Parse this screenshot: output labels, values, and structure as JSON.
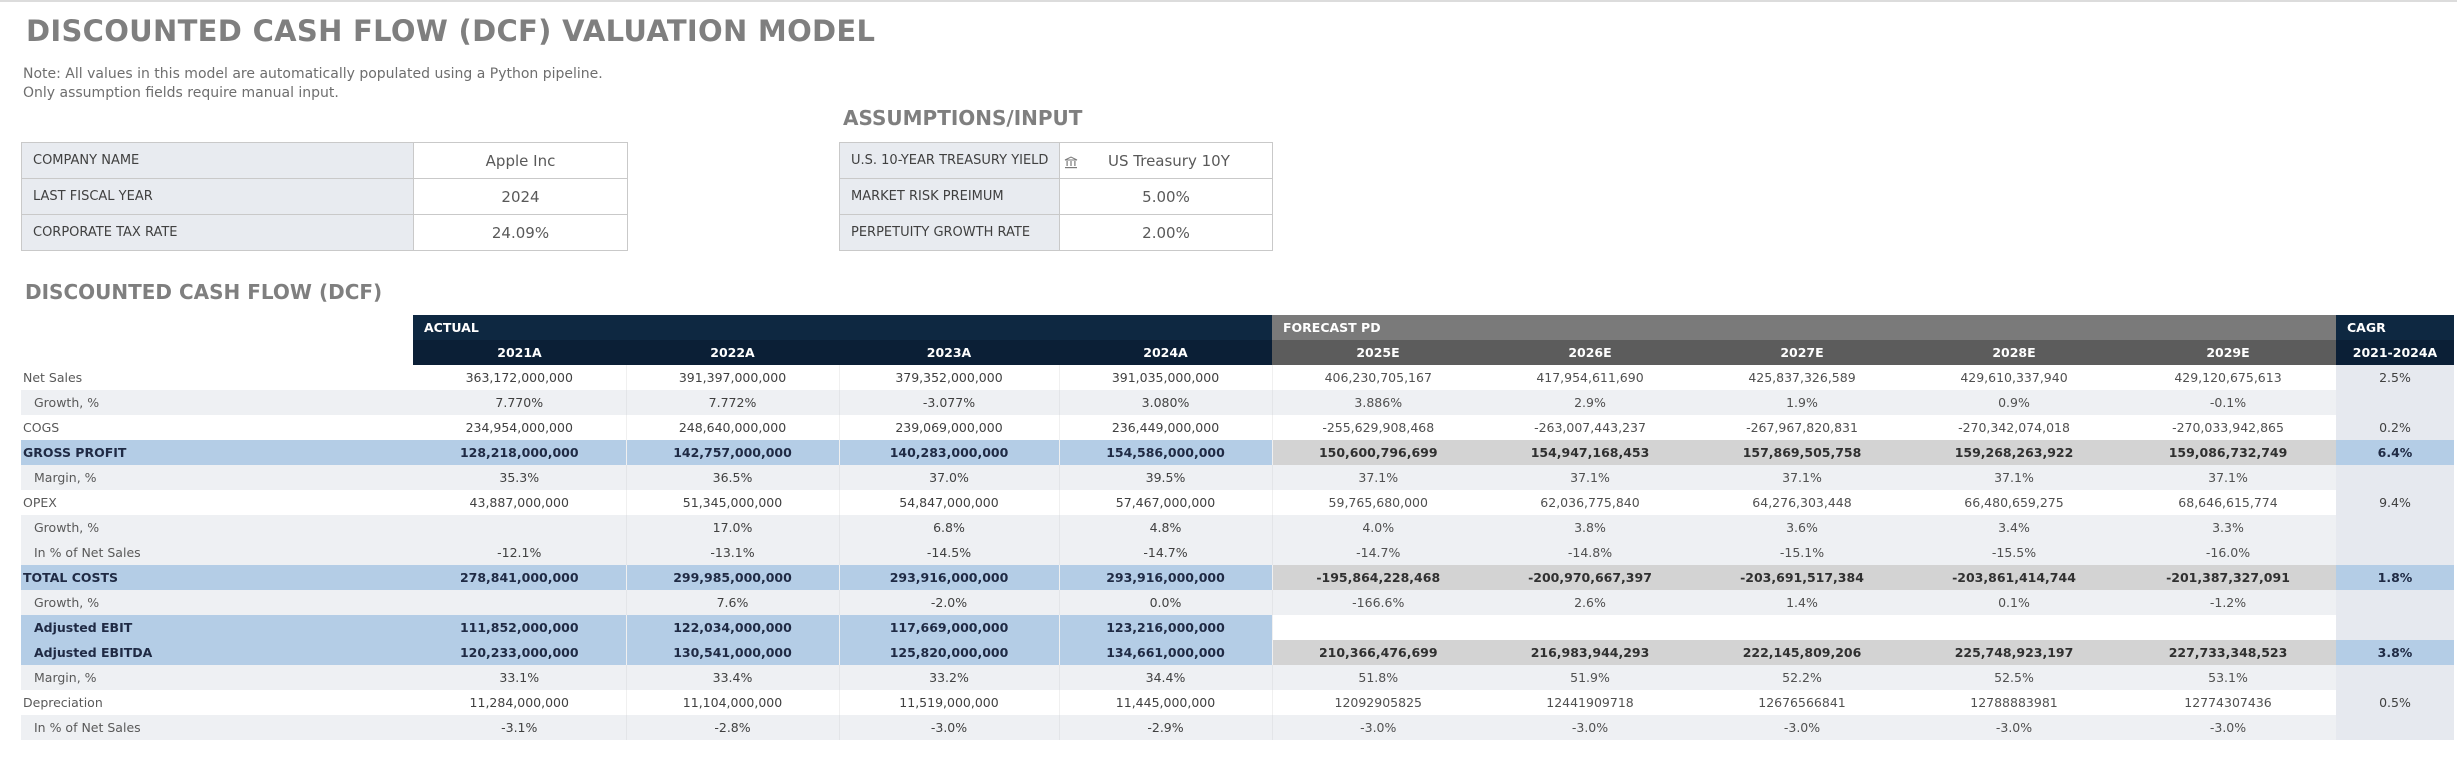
{
  "title": "DISCOUNTED CASH FLOW (DCF) VALUATION MODEL",
  "note": "Note: All values in this model are automatically populated using a Python pipeline. Only assumption fields require manual input.",
  "assumptions_title": "ASSUMPTIONS/INPUT",
  "dcf_title": "DISCOUNTED CASH FLOW (DCF)",
  "company": {
    "rows": [
      {
        "label": "COMPANY NAME",
        "value": "Apple Inc"
      },
      {
        "label": "LAST FISCAL YEAR",
        "value": "2024"
      },
      {
        "label": "CORPORATE TAX RATE",
        "value": "24.09%"
      }
    ]
  },
  "assumptions": {
    "rows": [
      {
        "label": "U.S. 10-YEAR TREASURY YIELD",
        "value": "US Treasury 10Y",
        "icon": "bank-icon"
      },
      {
        "label": "MARKET RISK PREIMUM",
        "value": "5.00%"
      },
      {
        "label": "PERPETUITY GROWTH RATE",
        "value": "2.00%"
      }
    ]
  },
  "dcf": {
    "group_actual": "ACTUAL",
    "group_forecast": "FORECAST PD",
    "group_cagr": "CAGR",
    "years_actual": [
      "2021A",
      "2022A",
      "2023A",
      "2024A"
    ],
    "years_forecast": [
      "2025E",
      "2026E",
      "2027E",
      "2028E",
      "2029E"
    ],
    "cagr_period": "2021-2024A",
    "rows": [
      {
        "label": "Net Sales",
        "actual": [
          "363,172,000,000",
          "391,397,000,000",
          "379,352,000,000",
          "391,035,000,000"
        ],
        "forecast": [
          "406,230,705,167",
          "417,954,611,690",
          "425,837,326,589",
          "429,610,337,940",
          "429,120,675,613"
        ],
        "cagr": "2.5%"
      },
      {
        "label": "Growth, %",
        "actual": [
          "7.770%",
          "7.772%",
          "-3.077%",
          "3.080%"
        ],
        "forecast": [
          "3.886%",
          "2.9%",
          "1.9%",
          "0.9%",
          "-0.1%"
        ],
        "cagr": ""
      },
      {
        "label": "COGS",
        "actual": [
          "234,954,000,000",
          "248,640,000,000",
          "239,069,000,000",
          "236,449,000,000"
        ],
        "forecast": [
          "-255,629,908,468",
          "-263,007,443,237",
          "-267,967,820,831",
          "-270,342,074,018",
          "-270,033,942,865"
        ],
        "cagr": "0.2%"
      },
      {
        "label": "GROSS PROFIT",
        "actual": [
          "128,218,000,000",
          "142,757,000,000",
          "140,283,000,000",
          "154,586,000,000"
        ],
        "forecast": [
          "150,600,796,699",
          "154,947,168,453",
          "157,869,505,758",
          "159,268,263,922",
          "159,086,732,749"
        ],
        "cagr": "6.4%"
      },
      {
        "label": "Margin, %",
        "actual": [
          "35.3%",
          "36.5%",
          "37.0%",
          "39.5%"
        ],
        "forecast": [
          "37.1%",
          "37.1%",
          "37.1%",
          "37.1%",
          "37.1%"
        ],
        "cagr": ""
      },
      {
        "label": "OPEX",
        "actual": [
          "43,887,000,000",
          "51,345,000,000",
          "54,847,000,000",
          "57,467,000,000"
        ],
        "forecast": [
          "59,765,680,000",
          "62,036,775,840",
          "64,276,303,448",
          "66,480,659,275",
          "68,646,615,774"
        ],
        "cagr": "9.4%"
      },
      {
        "label": "Growth, %",
        "actual": [
          "",
          "17.0%",
          "6.8%",
          "4.8%"
        ],
        "forecast": [
          "4.0%",
          "3.8%",
          "3.6%",
          "3.4%",
          "3.3%"
        ],
        "cagr": ""
      },
      {
        "label": "In % of Net Sales",
        "actual": [
          "-12.1%",
          "-13.1%",
          "-14.5%",
          "-14.7%"
        ],
        "forecast": [
          "-14.7%",
          "-14.8%",
          "-15.1%",
          "-15.5%",
          "-16.0%"
        ],
        "cagr": ""
      },
      {
        "label": "TOTAL COSTS",
        "actual": [
          "278,841,000,000",
          "299,985,000,000",
          "293,916,000,000",
          "293,916,000,000"
        ],
        "forecast": [
          "-195,864,228,468",
          "-200,970,667,397",
          "-203,691,517,384",
          "-203,861,414,744",
          "-201,387,327,091"
        ],
        "cagr": "1.8%"
      },
      {
        "label": "Growth, %",
        "actual": [
          "",
          "7.6%",
          "-2.0%",
          "0.0%"
        ],
        "forecast": [
          "-166.6%",
          "2.6%",
          "1.4%",
          "0.1%",
          "-1.2%"
        ],
        "cagr": ""
      },
      {
        "label": "Adjusted EBIT",
        "actual": [
          "111,852,000,000",
          "122,034,000,000",
          "117,669,000,000",
          "123,216,000,000"
        ],
        "forecast": [
          "",
          "",
          "",
          "",
          ""
        ],
        "cagr": ""
      },
      {
        "label": "Adjusted EBITDA",
        "actual": [
          "120,233,000,000",
          "130,541,000,000",
          "125,820,000,000",
          "134,661,000,000"
        ],
        "forecast": [
          "210,366,476,699",
          "216,983,944,293",
          "222,145,809,206",
          "225,748,923,197",
          "227,733,348,523"
        ],
        "cagr": "3.8%"
      },
      {
        "label": "Margin, %",
        "actual": [
          "33.1%",
          "33.4%",
          "33.2%",
          "34.4%"
        ],
        "forecast": [
          "51.8%",
          "51.9%",
          "52.2%",
          "52.5%",
          "53.1%"
        ],
        "cagr": ""
      },
      {
        "label": "Depreciation",
        "actual": [
          "11,284,000,000",
          "11,104,000,000",
          "11,519,000,000",
          "11,445,000,000"
        ],
        "forecast": [
          "12092905825",
          "12441909718",
          "12676566841",
          "12788883981",
          "12774307436"
        ],
        "cagr": "0.5%"
      },
      {
        "label": "In % of Net Sales",
        "actual": [
          "-3.1%",
          "-2.8%",
          "-3.0%",
          "-2.9%"
        ],
        "forecast": [
          "-3.0%",
          "-3.0%",
          "-3.0%",
          "-3.0%",
          "-3.0%"
        ],
        "cagr": ""
      }
    ]
  }
}
